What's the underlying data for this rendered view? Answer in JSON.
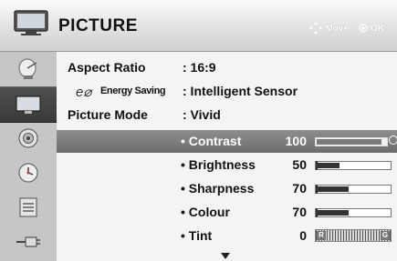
{
  "header": {
    "title": "PICTURE",
    "move_label": "Move",
    "ok_label": "OK"
  },
  "sidebar": {
    "items": [
      {
        "name": "picture-menu",
        "active": false
      },
      {
        "name": "picture",
        "active": true
      },
      {
        "name": "audio",
        "active": false
      },
      {
        "name": "time",
        "active": false
      },
      {
        "name": "option",
        "active": false
      },
      {
        "name": "input",
        "active": false
      }
    ]
  },
  "settings": {
    "aspect_ratio": {
      "label": "Aspect Ratio",
      "value": ": 16:9"
    },
    "energy_saving": {
      "icon": "eco-icon",
      "label": "Energy Saving",
      "value": ": Intelligent Sensor"
    },
    "picture_mode": {
      "label": "Picture Mode",
      "value": ": Vivid"
    }
  },
  "sub_items": [
    {
      "label": "• Contrast",
      "value": "100",
      "level": 100,
      "selected": true
    },
    {
      "label": "• Brightness",
      "value": "50",
      "level": 50,
      "selected": false
    },
    {
      "label": "• Sharpness",
      "value": "70",
      "level": 70,
      "selected": false
    },
    {
      "label": "• Colour",
      "value": "70",
      "level": 70,
      "selected": false
    }
  ],
  "tint": {
    "label": "• Tint",
    "value": "0",
    "left_end": "R",
    "right_end": "G"
  },
  "colors": {
    "accent": "#6c6c6c",
    "selected_row": "#7a7a7a"
  }
}
